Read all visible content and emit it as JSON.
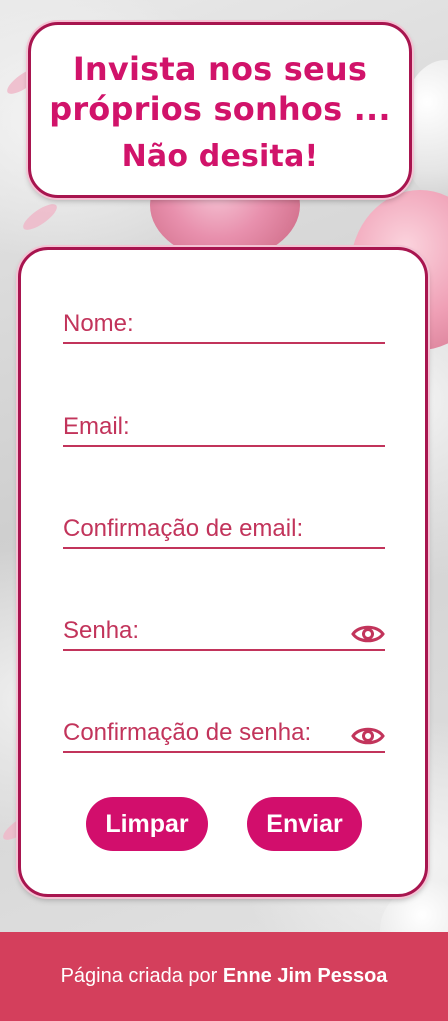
{
  "header": {
    "line1": "Invista nos seus",
    "line2": "próprios sonhos ...",
    "line3": "Não desita!"
  },
  "form": {
    "fields": [
      {
        "label": "Nome:",
        "value": ""
      },
      {
        "label": "Email:",
        "value": ""
      },
      {
        "label": "Confirmação de email:",
        "value": ""
      },
      {
        "label": "Senha:",
        "value": "",
        "icon": "eye-icon"
      },
      {
        "label": "Confirmação de senha:",
        "value": "",
        "icon": "eye-icon"
      }
    ],
    "buttons": {
      "clear_label": "Limpar",
      "submit_label": "Enviar"
    }
  },
  "footer": {
    "prefix": "Página criada por",
    "author": "Enne Jim Pessoa"
  },
  "colors": {
    "accent": "#d20e6c",
    "label": "#c2345b",
    "border": "#a8154f",
    "footer_bg": "#d43f5c"
  }
}
